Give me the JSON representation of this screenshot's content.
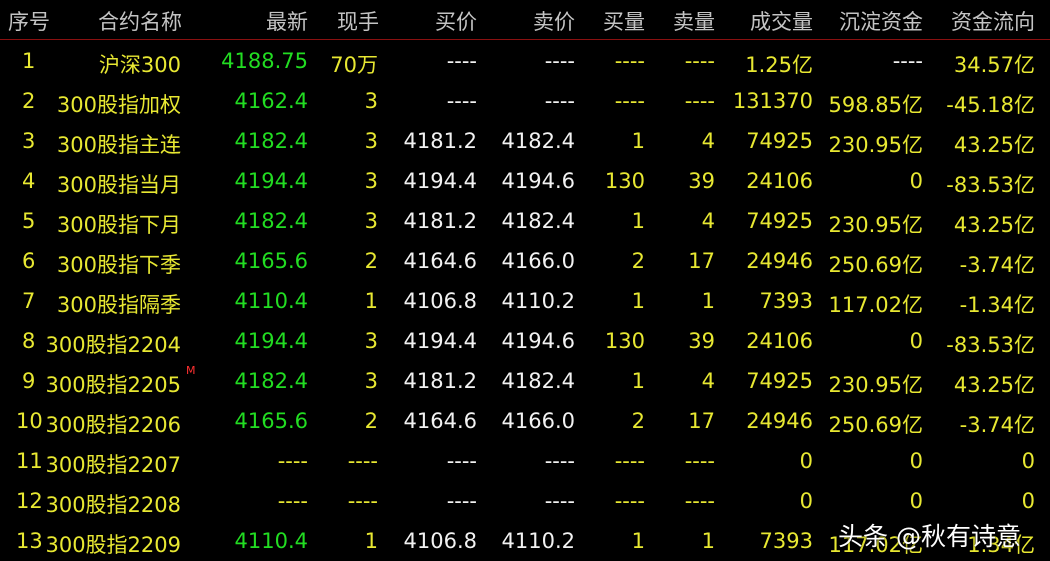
{
  "columns": [
    "序号",
    "合约名称",
    "最新",
    "现手",
    "买价",
    "卖价",
    "买量",
    "卖量",
    "成交量",
    "沉淀资金",
    "资金流向"
  ],
  "rows": [
    {
      "idx": "1",
      "name": "沪深300",
      "last": "4188.75",
      "hand": "70万",
      "bid": "----",
      "ask": "----",
      "bidv": "----",
      "askv": "----",
      "vol": "1.25亿",
      "fund": "----",
      "flow": "34.57亿"
    },
    {
      "idx": "2",
      "name": "300股指加权",
      "last": "4162.4",
      "hand": "3",
      "bid": "----",
      "ask": "----",
      "bidv": "----",
      "askv": "----",
      "vol": "131370",
      "fund": "598.85亿",
      "flow": "-45.18亿"
    },
    {
      "idx": "3",
      "name": "300股指主连",
      "last": "4182.4",
      "hand": "3",
      "bid": "4181.2",
      "ask": "4182.4",
      "bidv": "1",
      "askv": "4",
      "vol": "74925",
      "fund": "230.95亿",
      "flow": "43.25亿"
    },
    {
      "idx": "4",
      "name": "300股指当月",
      "last": "4194.4",
      "hand": "3",
      "bid": "4194.4",
      "ask": "4194.6",
      "bidv": "130",
      "askv": "39",
      "vol": "24106",
      "fund": "0",
      "flow": "-83.53亿"
    },
    {
      "idx": "5",
      "name": "300股指下月",
      "last": "4182.4",
      "hand": "3",
      "bid": "4181.2",
      "ask": "4182.4",
      "bidv": "1",
      "askv": "4",
      "vol": "74925",
      "fund": "230.95亿",
      "flow": "43.25亿"
    },
    {
      "idx": "6",
      "name": "300股指下季",
      "last": "4165.6",
      "hand": "2",
      "bid": "4164.6",
      "ask": "4166.0",
      "bidv": "2",
      "askv": "17",
      "vol": "24946",
      "fund": "250.69亿",
      "flow": "-3.74亿"
    },
    {
      "idx": "7",
      "name": "300股指隔季",
      "last": "4110.4",
      "hand": "1",
      "bid": "4106.8",
      "ask": "4110.2",
      "bidv": "1",
      "askv": "1",
      "vol": "7393",
      "fund": "117.02亿",
      "flow": "-1.34亿"
    },
    {
      "idx": "8",
      "name": "300股指2204",
      "last": "4194.4",
      "hand": "3",
      "bid": "4194.4",
      "ask": "4194.6",
      "bidv": "130",
      "askv": "39",
      "vol": "24106",
      "fund": "0",
      "flow": "-83.53亿"
    },
    {
      "idx": "9",
      "name": "300股指2205",
      "flag": "M",
      "last": "4182.4",
      "hand": "3",
      "bid": "4181.2",
      "ask": "4182.4",
      "bidv": "1",
      "askv": "4",
      "vol": "74925",
      "fund": "230.95亿",
      "flow": "43.25亿"
    },
    {
      "idx": "10",
      "name": "300股指2206",
      "last": "4165.6",
      "hand": "2",
      "bid": "4164.6",
      "ask": "4166.0",
      "bidv": "2",
      "askv": "17",
      "vol": "24946",
      "fund": "250.69亿",
      "flow": "-3.74亿"
    },
    {
      "idx": "11",
      "name": "300股指2207",
      "last": "----",
      "hand": "----",
      "bid": "----",
      "ask": "----",
      "bidv": "----",
      "askv": "----",
      "vol": "0",
      "fund": "0",
      "flow": "0"
    },
    {
      "idx": "12",
      "name": "300股指2208",
      "last": "----",
      "hand": "----",
      "bid": "----",
      "ask": "----",
      "bidv": "----",
      "askv": "----",
      "vol": "0",
      "fund": "0",
      "flow": "0"
    },
    {
      "idx": "13",
      "name": "300股指2209",
      "last": "4110.4",
      "hand": "1",
      "bid": "4106.8",
      "ask": "4110.2",
      "bidv": "1",
      "askv": "1",
      "vol": "7393",
      "fund": "117.02亿",
      "flow": "1.34亿"
    }
  ],
  "watermark": "头条 @秋有诗意",
  "colors": {
    "background": "#000000",
    "header_text": "#c4c4c4",
    "yellow": "#e8e832",
    "green": "#22dd22",
    "white": "#f2f2f2",
    "separator": "#8a1010",
    "flag": "#ff3030"
  }
}
